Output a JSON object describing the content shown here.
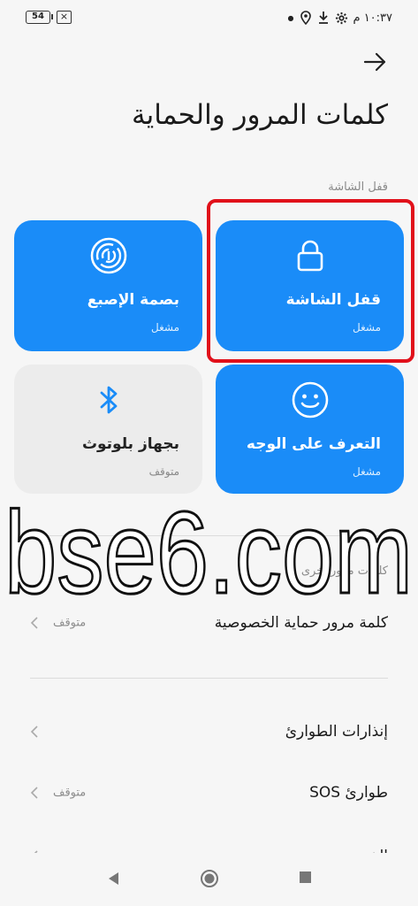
{
  "status_bar": {
    "battery": "54",
    "time": "١٠:٣٧ م"
  },
  "header": {
    "title": "كلمات المرور والحماية"
  },
  "sections": {
    "screen_lock_header": "قفل الشاشة",
    "other_passwords_header": "كلمات مرور أخرى"
  },
  "tiles": [
    {
      "label": "قفل الشاشة",
      "status": "مشغل",
      "icon": "lock-icon"
    },
    {
      "label": "بصمة الإصبع",
      "status": "مشغل",
      "icon": "fingerprint-icon"
    },
    {
      "label": "التعرف على الوجه",
      "status": "مشغل",
      "icon": "face-icon"
    },
    {
      "label": "بجهاز بلوتوث",
      "status": "متوقف",
      "icon": "bluetooth-icon"
    }
  ],
  "rows": [
    {
      "title": "كلمة مرور حماية الخصوصية",
      "value": "متوقف"
    },
    {
      "title": "إنذارات الطوارئ",
      "value": ""
    },
    {
      "title": "طوارئ SOS",
      "value": "متوقف"
    },
    {
      "title": "الخصوصية",
      "value": ""
    }
  ],
  "watermark": {
    "text": "bse6.com"
  },
  "colors": {
    "accent": "#1a8cf8",
    "highlight": "#e1101a",
    "background": "#f6f6f6"
  }
}
